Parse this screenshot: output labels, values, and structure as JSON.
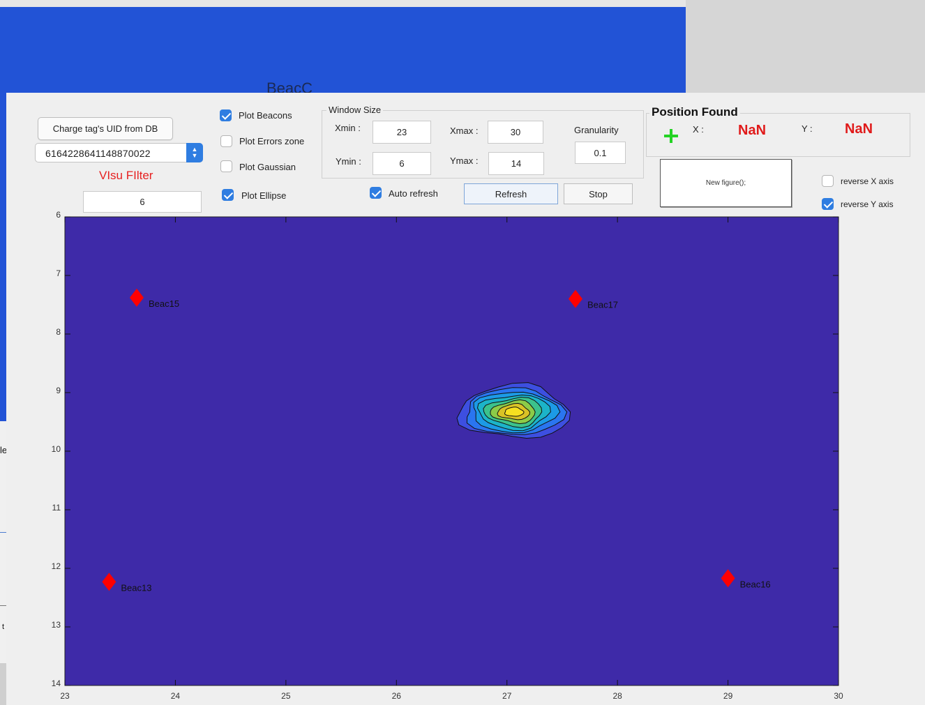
{
  "background_window": {
    "title": "BeacC",
    "left_text_1": "le",
    "left_text_2": "t"
  },
  "controls": {
    "charge_button": "Charge tag's UID from DB",
    "uid_select_value": "6164228641148870022",
    "visu_filter_label": "VIsu FIlter",
    "visu_filter_value": "6",
    "checkboxes": [
      {
        "label": "Plot Beacons",
        "checked": true
      },
      {
        "label": "Plot Errors zone",
        "checked": false
      },
      {
        "label": "Plot Gaussian",
        "checked": false
      },
      {
        "label": "Plot Ellipse",
        "checked": true
      }
    ],
    "auto_refresh": {
      "label": "Auto refresh",
      "checked": true
    },
    "refresh_button": "Refresh",
    "stop_button": "Stop"
  },
  "window_size": {
    "title": "Window Size",
    "xmin_label": "Xmin :",
    "xmin": "23",
    "xmax_label": "Xmax :",
    "xmax": "30",
    "ymin_label": "Ymin :",
    "ymin": "6",
    "ymax_label": "Ymax :",
    "ymax": "14",
    "granularity_label": "Granularity",
    "granularity": "0.1"
  },
  "position_found": {
    "title": "Position Found",
    "x_label": "X :",
    "x_value": "NaN",
    "y_label": "Y :",
    "y_value": "NaN",
    "icon": "green-plus-icon"
  },
  "new_figure_label": "New figure();",
  "axis_options": [
    {
      "label": "reverse X axis",
      "checked": false
    },
    {
      "label": "reverse Y axis",
      "checked": true
    }
  ],
  "chart_data": {
    "type": "scatter",
    "xlim": [
      23,
      30
    ],
    "ylim": [
      6,
      14
    ],
    "y_reversed": true,
    "x_ticks": [
      "23",
      "24",
      "25",
      "26",
      "27",
      "28",
      "29",
      "30"
    ],
    "y_ticks": [
      "6",
      "7",
      "8",
      "9",
      "10",
      "11",
      "12",
      "13",
      "14"
    ],
    "background_color": "#3e2aa8",
    "beacons": [
      {
        "name": "Beac15",
        "x": 23.65,
        "y": 7.38
      },
      {
        "name": "Beac17",
        "x": 27.62,
        "y": 7.4
      },
      {
        "name": "Beac13",
        "x": 23.4,
        "y": 12.23
      },
      {
        "name": "Beac16",
        "x": 29.0,
        "y": 12.17
      }
    ],
    "beacon_color": "#ff0000",
    "contour_center": {
      "x": 27.05,
      "y": 9.33
    },
    "contour_levels": [
      "#3d4fe0",
      "#2a75f0",
      "#1c9ae6",
      "#1cb4c8",
      "#3cc28c",
      "#8ccb48",
      "#d9c226",
      "#f6e020"
    ]
  }
}
